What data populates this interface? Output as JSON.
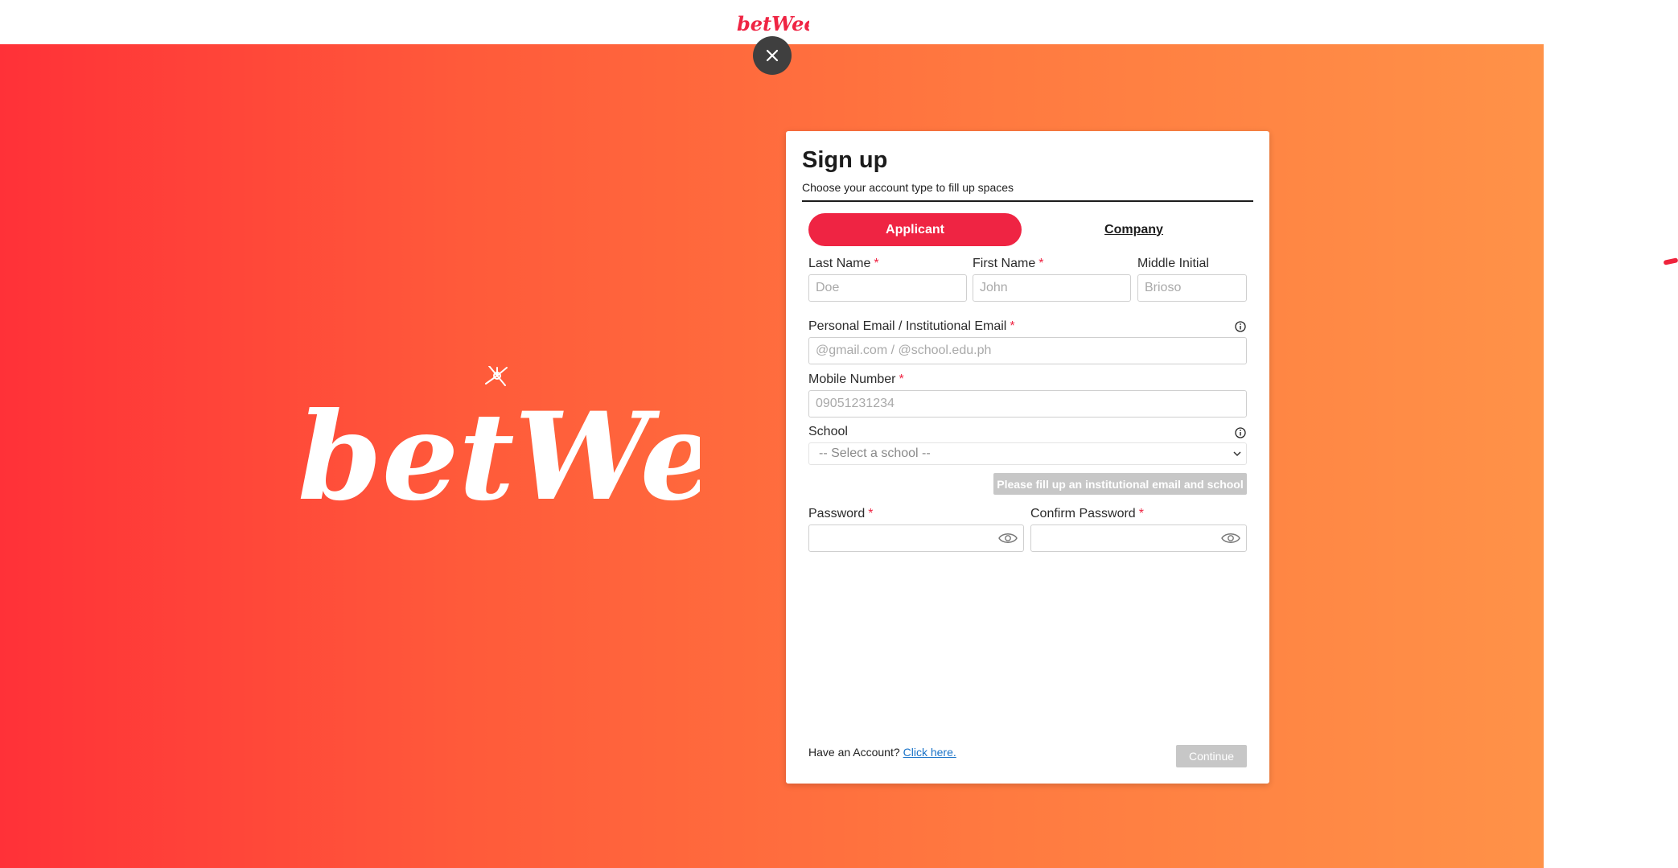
{
  "brand": {
    "logo_text": "betWeen",
    "accent_color": "#ef2443",
    "gradient_start": "#ff3138",
    "gradient_end": "#ff9248"
  },
  "close_button": {
    "icon": "close-icon"
  },
  "signup": {
    "title": "Sign up",
    "subtitle": "Choose your account type to fill up spaces",
    "tabs": [
      {
        "label": "Applicant",
        "active": true
      },
      {
        "label": "Company",
        "active": false
      }
    ],
    "fields": {
      "last_name": {
        "label": "Last Name",
        "required_mark": "*",
        "placeholder": "Doe",
        "value": ""
      },
      "first_name": {
        "label": "First Name",
        "required_mark": "*",
        "placeholder": "John",
        "value": ""
      },
      "middle_initial": {
        "label": "Middle Initial",
        "placeholder": "Brioso",
        "value": ""
      },
      "email": {
        "label": "Personal Email / Institutional Email",
        "required_mark": "*",
        "placeholder": "@gmail.com / @school.edu.ph",
        "value": "",
        "info_icon": "info-icon"
      },
      "mobile": {
        "label": "Mobile Number",
        "required_mark": "*",
        "placeholder": "09051231234",
        "value": ""
      },
      "school": {
        "label": "School",
        "selected": "-- Select a school --",
        "info_icon": "info-icon"
      },
      "password": {
        "label": "Password",
        "required_mark": "*",
        "value": "",
        "icon": "eye-icon"
      },
      "confirm_password": {
        "label": "Confirm Password",
        "required_mark": "*",
        "value": "",
        "icon": "eye-icon"
      }
    },
    "school_button": "Please fill up an institutional email and school",
    "footer": {
      "have_account": "Have an Account?",
      "link": "Click here.",
      "continue": "Continue"
    }
  }
}
